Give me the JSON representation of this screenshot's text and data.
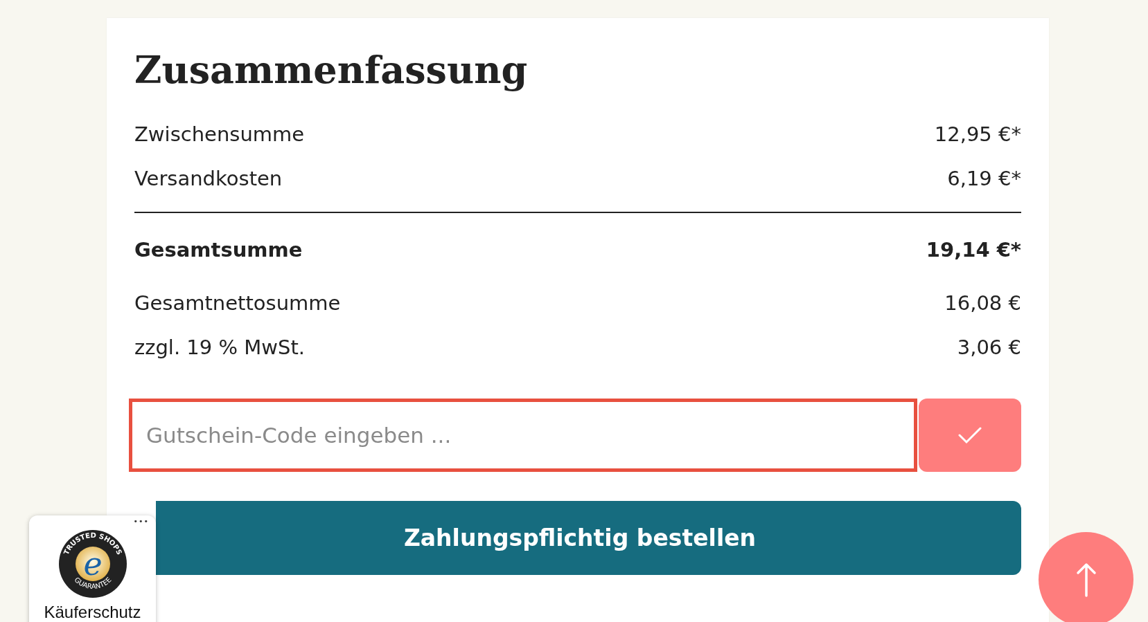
{
  "summary": {
    "title": "Zusammenfassung",
    "rows": [
      {
        "label": "Zwischensumme",
        "value": "12,95 €*",
        "kind": "plain"
      },
      {
        "label": "Versandkosten",
        "value": "6,19 €*",
        "kind": "plain"
      },
      {
        "label": "Gesamtsumme",
        "value": "19,14 €*",
        "kind": "total"
      },
      {
        "label": "Gesamtnettosumme",
        "value": "16,08 €",
        "kind": "plain"
      },
      {
        "label": "zzgl. 19 % MwSt.",
        "value": "3,06 €",
        "kind": "plain"
      }
    ],
    "voucher": {
      "placeholder": "Gutschein-Code eingeben ...",
      "invalid": true
    },
    "order_button": "Zahlungspflichtig bestellen"
  },
  "trust_badge": {
    "menu": "•••",
    "seal_top": "TRUSTED SHOPS",
    "seal_letter": "e",
    "seal_bottom": "GUARANTEE",
    "label": "Käuferschutz"
  }
}
